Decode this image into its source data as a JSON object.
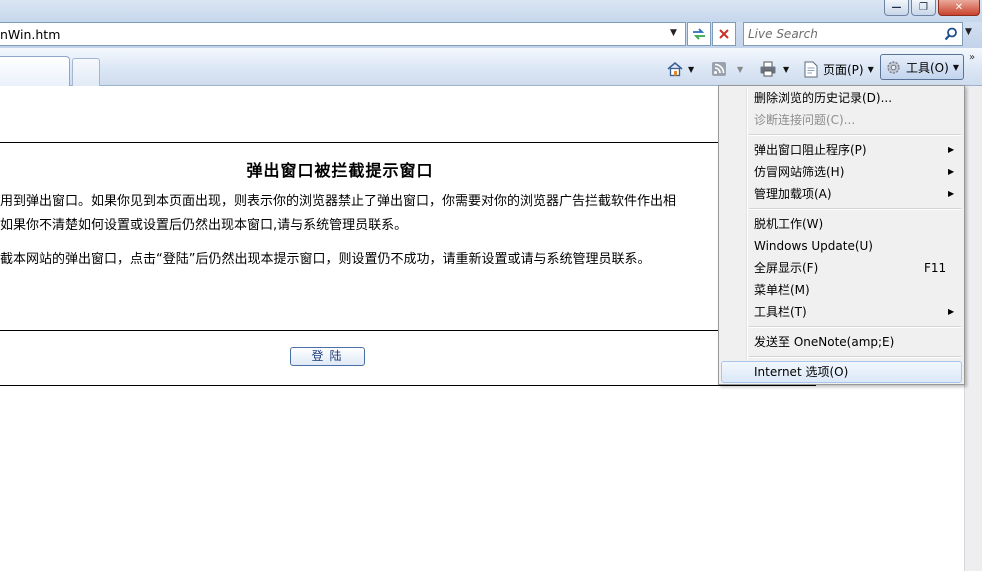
{
  "window": {
    "buttons": {
      "minimize": "—",
      "maximize": "❐",
      "close": "✕"
    }
  },
  "address": {
    "url": "nWin.htm"
  },
  "search": {
    "placeholder": "Live Search"
  },
  "commands": {
    "page_label": "页面(P)",
    "tools_label": "工具(O)"
  },
  "page": {
    "heading": "弹出窗口被拦截提示窗口",
    "lines": [
      "用到弹出窗口。如果你见到本页面出现，则表示你的浏览器禁止了弹出窗口，你需要对你的浏览器广告拦截软件作出相",
      "如果你不清楚如何设置或设置后仍然出现本窗口,请与系统管理员联系。",
      "截本网站的弹出窗口，点击“登陆”后仍然出现本提示窗口，则设置仍不成功，请重新设置或请与系统管理员联系。"
    ],
    "login_button": "登陆"
  },
  "tools_menu": {
    "items": [
      {
        "label": "删除浏览的历史记录(D)..."
      },
      {
        "label": "诊断连接问题(C)..."
      },
      {
        "label": "弹出窗口阻止程序(P)"
      },
      {
        "label": "仿冒网站筛选(H)"
      },
      {
        "label": "管理加载项(A)"
      },
      {
        "label": "脱机工作(W)"
      },
      {
        "label": "Windows Update(U)"
      },
      {
        "label": "全屏显示(F)",
        "shortcut": "F11"
      },
      {
        "label": "菜单栏(M)"
      },
      {
        "label": "工具栏(T)"
      },
      {
        "label": "发送至 OneNote(amp;E)"
      },
      {
        "label": "Internet 选项(O)"
      }
    ]
  },
  "icons": {
    "home": "home-icon",
    "feeds": "rss-icon",
    "print": "printer-icon",
    "page": "page-icon",
    "tools": "gear-icon",
    "search": "magnifier-icon",
    "refresh": "refresh-icon",
    "stop": "stop-icon",
    "more": "chevron-more-icon"
  }
}
